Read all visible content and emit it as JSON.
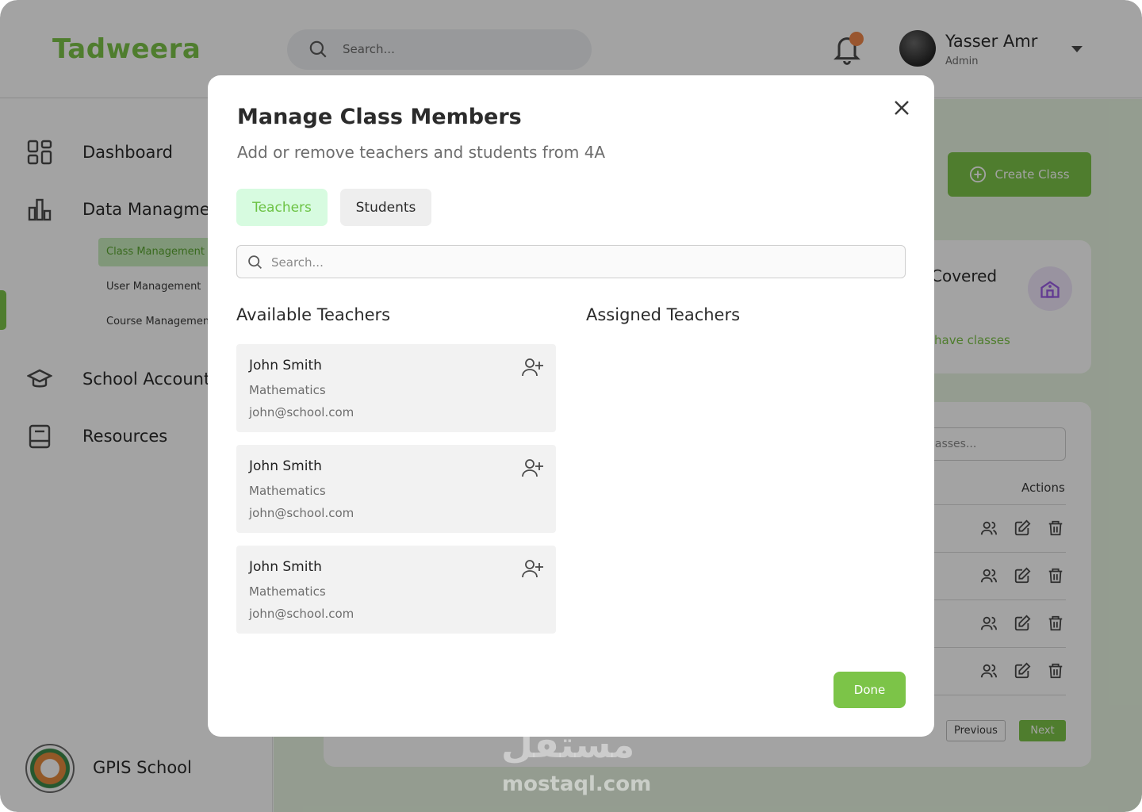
{
  "app": {
    "logo": "Tadweera",
    "search_placeholder": "Search...",
    "user": {
      "name": "Yasser Amr",
      "role": "Admin"
    }
  },
  "sidebar": {
    "items": [
      {
        "label": "Dashboard",
        "icon": "grid-icon"
      },
      {
        "label": "Data Managment",
        "icon": "bar-chart-icon"
      },
      {
        "label": "School Accounts",
        "icon": "graduation-cap-icon"
      },
      {
        "label": "Resources",
        "icon": "book-icon"
      }
    ],
    "sub_items": [
      {
        "label": "Class Management",
        "active": true
      },
      {
        "label": "User Management",
        "active": false
      },
      {
        "label": "Course Management",
        "active": false
      }
    ],
    "school_name": "GPIS School"
  },
  "page": {
    "create_button": "Create Class",
    "stat_title": "Covered",
    "stat_sub": "have classes",
    "table_search_placeholder": "lasses...",
    "actions_header": "Actions",
    "prev_label": "Previous",
    "next_label": "Next"
  },
  "modal": {
    "title": "Manage Class Members",
    "subtitle": "Add or remove teachers and students from 4A",
    "tabs": [
      {
        "label": "Teachers",
        "active": true
      },
      {
        "label": "Students",
        "active": false
      }
    ],
    "search_placeholder": "Search...",
    "available_heading": "Available Teachers",
    "assigned_heading": "Assigned Teachers",
    "available_teachers": [
      {
        "name": "John Smith",
        "subject": "Mathematics",
        "email": "john@school.com"
      },
      {
        "name": "John Smith",
        "subject": "Mathematics",
        "email": "john@school.com"
      },
      {
        "name": "John Smith",
        "subject": "Mathematics",
        "email": "john@school.com"
      }
    ],
    "assigned_teachers": [],
    "done_label": "Done"
  },
  "watermark": {
    "arabic": "مستقل",
    "latin": "mostaql.com"
  },
  "colors": {
    "accent": "#7cc448",
    "tab_active_bg": "#d7fbe0",
    "overlay": "rgba(0,0,0,0.36)"
  }
}
